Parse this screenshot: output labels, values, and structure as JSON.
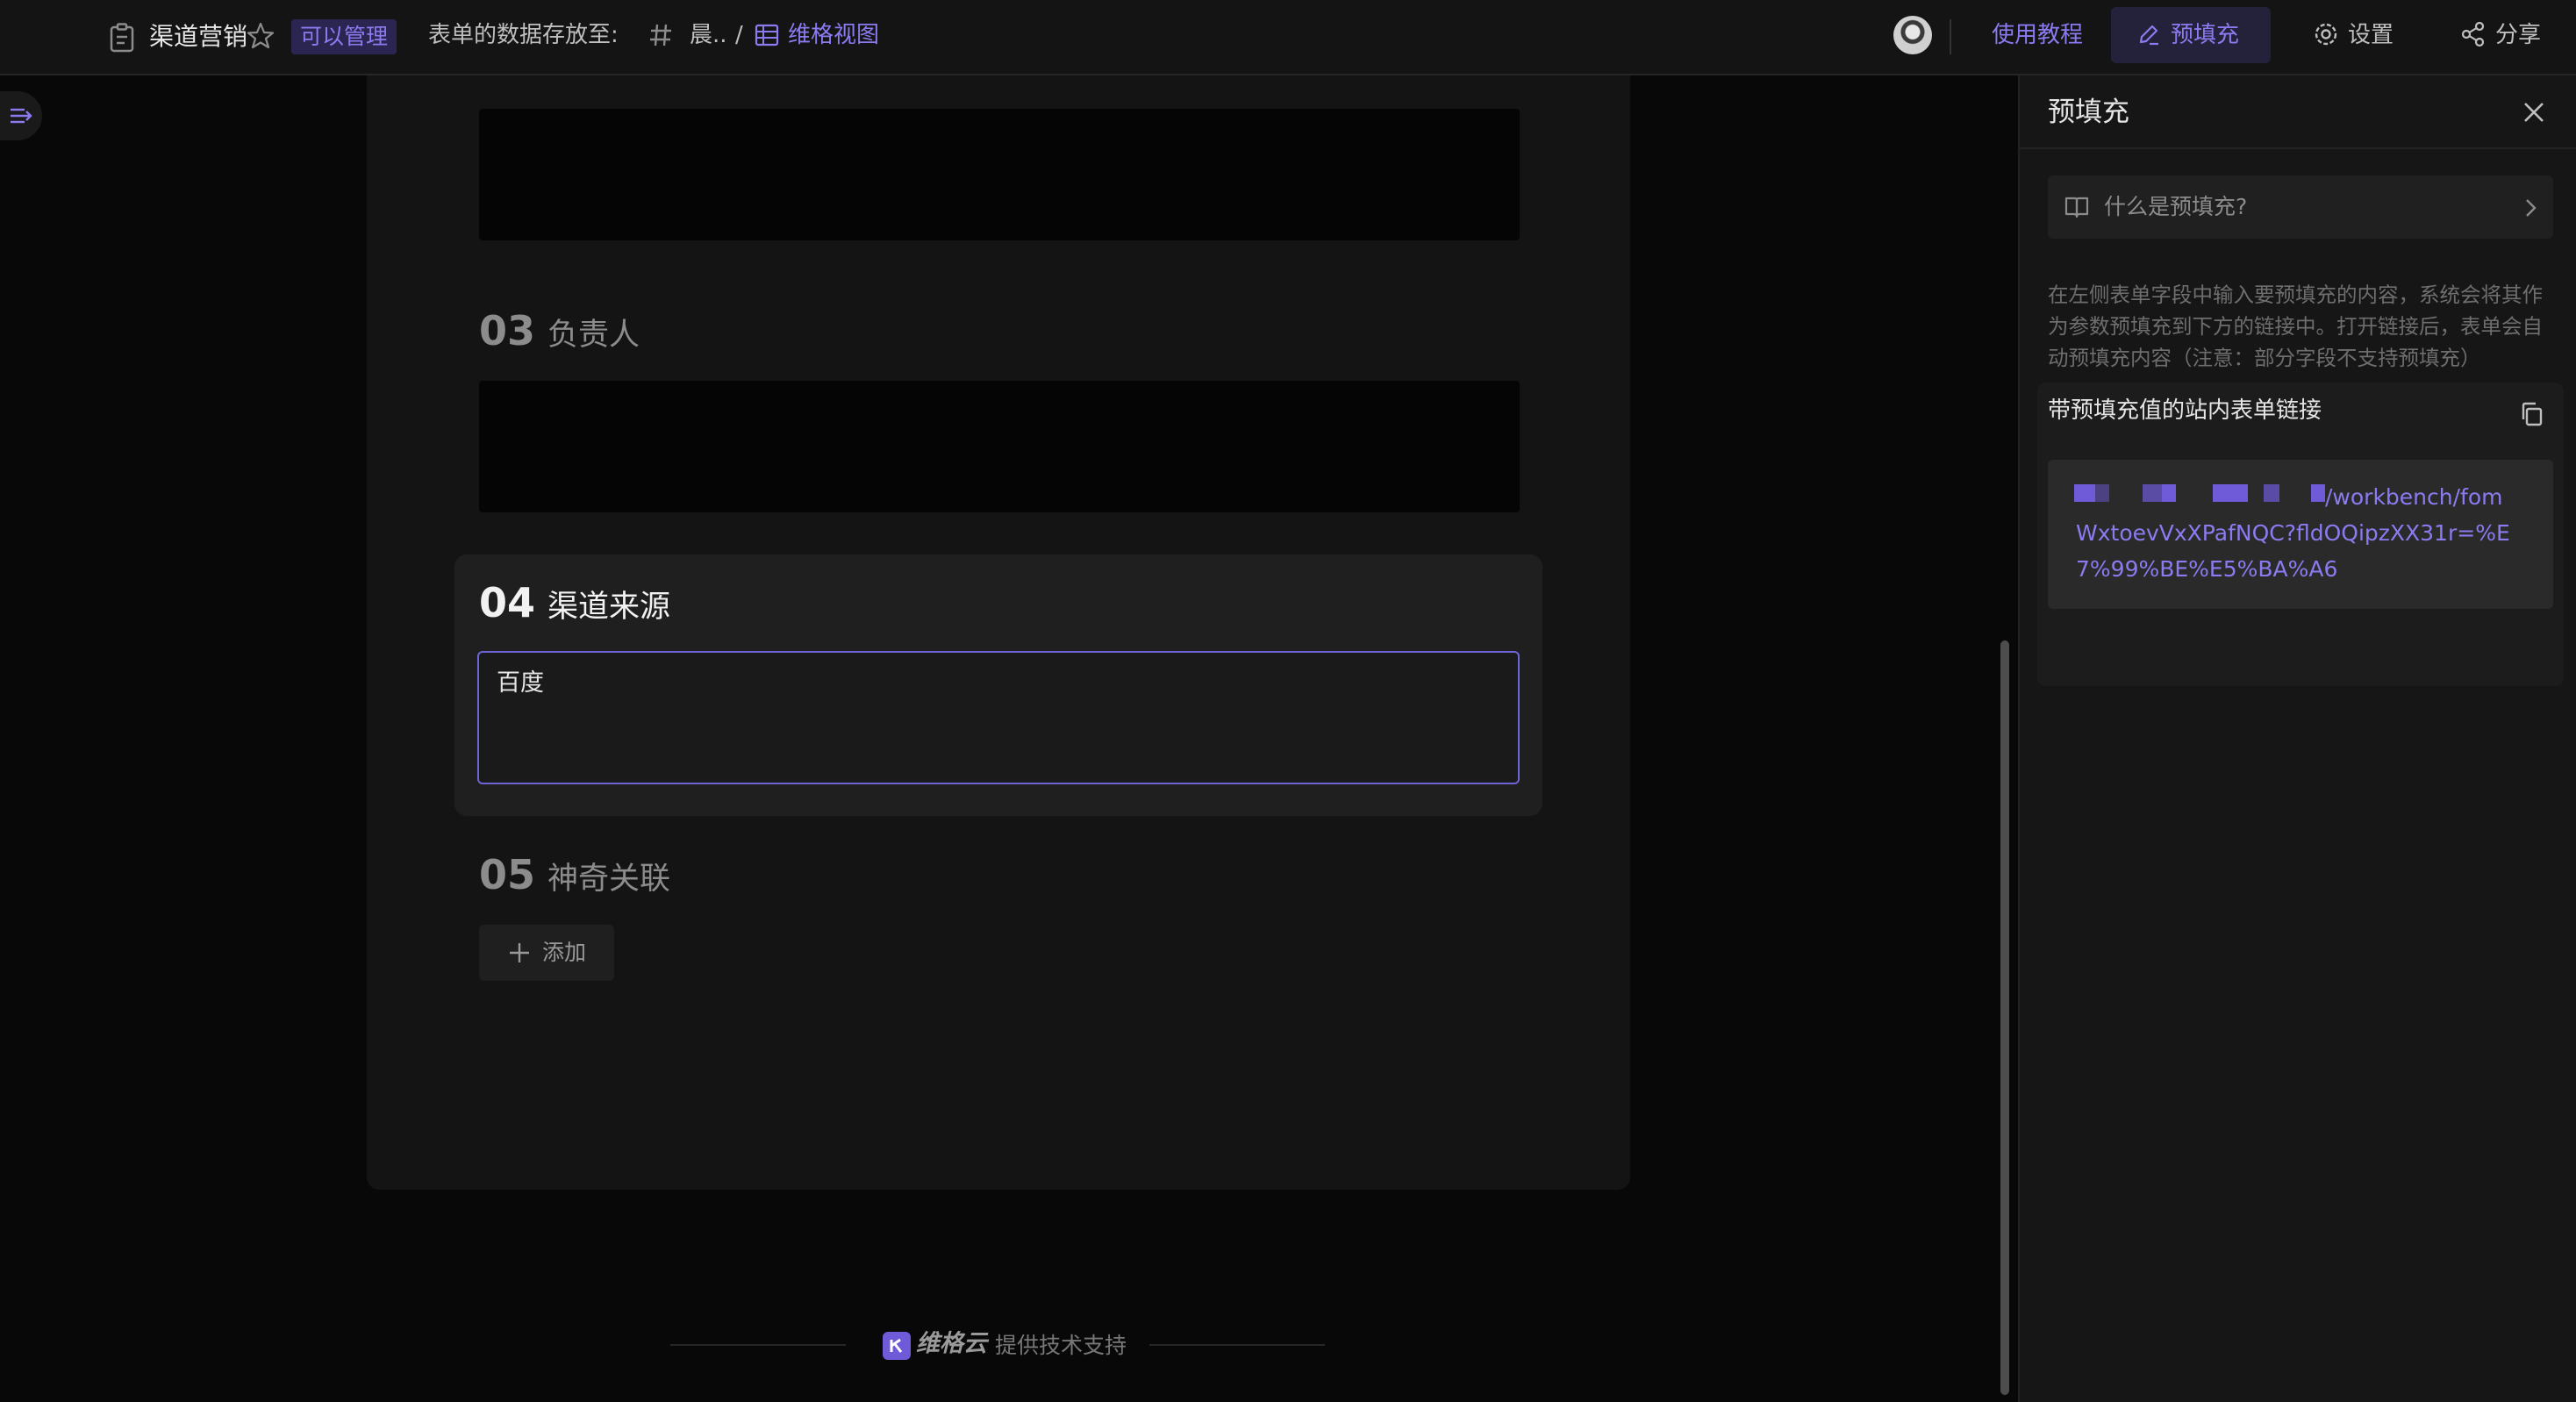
{
  "header": {
    "title": "渠道营销",
    "badge": "可以管理",
    "store_label": "表单的数据存放至:",
    "crumb_workspace": "晨..",
    "crumb_sep": "/",
    "crumb_view": "维格视图",
    "tutorial": "使用教程",
    "prefill": "预填充",
    "settings": "设置",
    "share": "分享"
  },
  "form": {
    "q3_num": "03",
    "q3_label": "负责人",
    "q4_num": "04",
    "q4_label": "渠道来源",
    "q4_value": "百度",
    "q5_num": "05",
    "q5_label": "神奇关联",
    "add_label": "添加"
  },
  "footer": {
    "brand": "维格云",
    "text": "提供技术支持"
  },
  "panel": {
    "title": "预填充",
    "help": "什么是预填充?",
    "desc": "在左侧表单字段中输入要预填充的内容，系统会将其作为参数预填充到下方的链接中。打开链接后，表单会自动预填充内容（注意：部分字段不支持预填充）",
    "link_label": "带预填充值的站内表单链接",
    "link_line1": "/workbench/fom",
    "link_line2": "WxtoevVxXPafNQC?fldOQipzXX31r=%E",
    "link_line3": "7%99%BE%E5%BA%A6"
  },
  "colors": {
    "accent": "#8a7bf0",
    "background": "#080808",
    "card": "#141414",
    "panel": "#161616"
  },
  "icons": [
    "doc-icon",
    "star-icon",
    "hash-icon",
    "grid-view-icon",
    "avatar",
    "edit-icon",
    "gear-icon",
    "share-icon",
    "sidebar-toggle-icon",
    "plus-icon",
    "book-icon",
    "chevron-right-icon",
    "close-icon",
    "copy-icon",
    "brand-logo-icon"
  ]
}
